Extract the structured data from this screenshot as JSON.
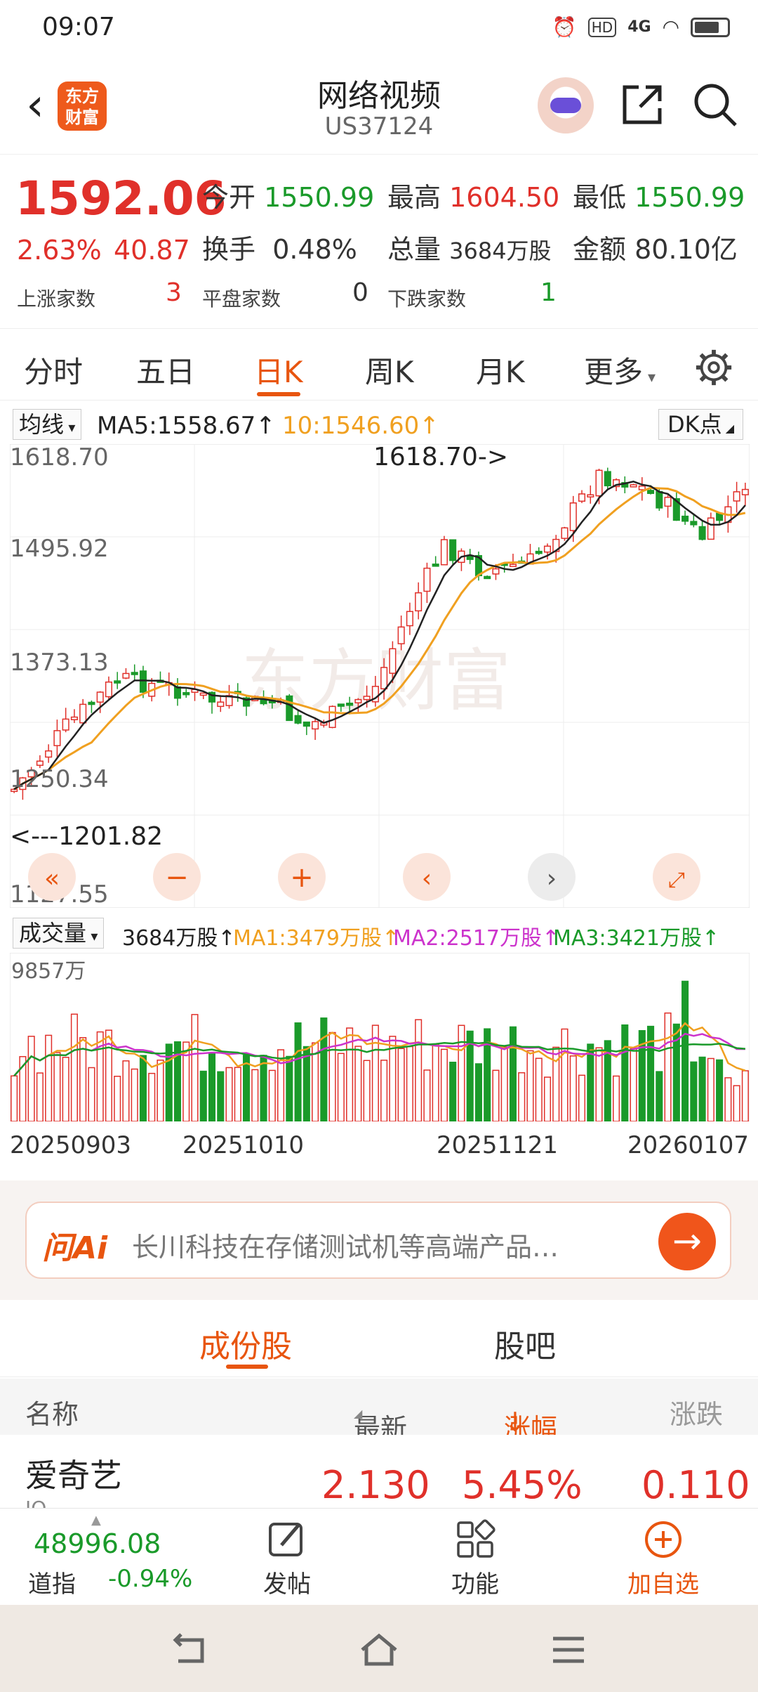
{
  "status_bar": {
    "time": "09:07",
    "icons": [
      "alarm-icon",
      "hd-icon",
      "signal-4g-icon",
      "wifi-icon",
      "battery-icon"
    ],
    "hd": "HD",
    "net": "4G"
  },
  "header": {
    "title": "网络视频",
    "code": "US37124",
    "brand_logo_text": "东方财富"
  },
  "quote": {
    "price": "1592.06",
    "change_pct": "2.63%",
    "change_val": "40.87",
    "open_label": "今开",
    "open": "1550.99",
    "high_label": "最高",
    "high": "1604.50",
    "low_label": "最低",
    "low": "1550.99",
    "turnover_label": "换手",
    "turnover": "0.48%",
    "volume_label": "总量",
    "volume": "3684万股",
    "amount_label": "金额",
    "amount": "80.10亿",
    "up_label": "上涨家数",
    "up": "3",
    "flat_label": "平盘家数",
    "flat": "0",
    "down_label": "下跌家数",
    "down": "1"
  },
  "period_tabs": [
    "分时",
    "五日",
    "日K",
    "周K",
    "月K",
    "更多"
  ],
  "active_period": "日K",
  "ma_bar": {
    "select": "均线",
    "ma5": "MA5:1558.67↑",
    "ma10": "10:1546.60↑",
    "dk": "DK点"
  },
  "kline": {
    "y_labels": [
      "1618.70",
      "1495.92",
      "1373.13",
      "1250.34",
      "1127.55"
    ],
    "max_marker": "1618.70->",
    "min_marker": "<---1201.82",
    "watermark": "东方财富"
  },
  "vol_bar": {
    "select": "成交量",
    "total": "3684万股↑",
    "ma1": "MA1:3479万股↑",
    "ma2": "MA2:2517万股↑",
    "ma3": "MA3:3421万股↑",
    "ymax": "9857万"
  },
  "dates": [
    "20250903",
    "20251010",
    "20251121",
    "20260107"
  ],
  "colors": {
    "up": "#e0302a",
    "down": "#1a9a2a",
    "accent": "#e8550f",
    "ma5": "#222222",
    "ma10": "#f0a020",
    "ma2": "#cc33cc",
    "ma3": "#1a9a2a"
  },
  "ai": {
    "logo": "问Ai",
    "text": "长川科技在存储测试机等高端产品领…"
  },
  "sub_tabs": [
    "成份股",
    "股吧"
  ],
  "table": {
    "headers": [
      "名称",
      "最新",
      "涨幅",
      "涨跌"
    ],
    "rows": [
      {
        "name": "爱奇艺",
        "code": "IQ",
        "price": "2.130",
        "pct": "5.45%",
        "chg": "0.110"
      }
    ]
  },
  "toolbar": {
    "index_value": "48996.08",
    "index_name": "道指",
    "index_pct": "-0.94%",
    "post": "发帖",
    "function": "功能",
    "add": "加自选"
  }
}
